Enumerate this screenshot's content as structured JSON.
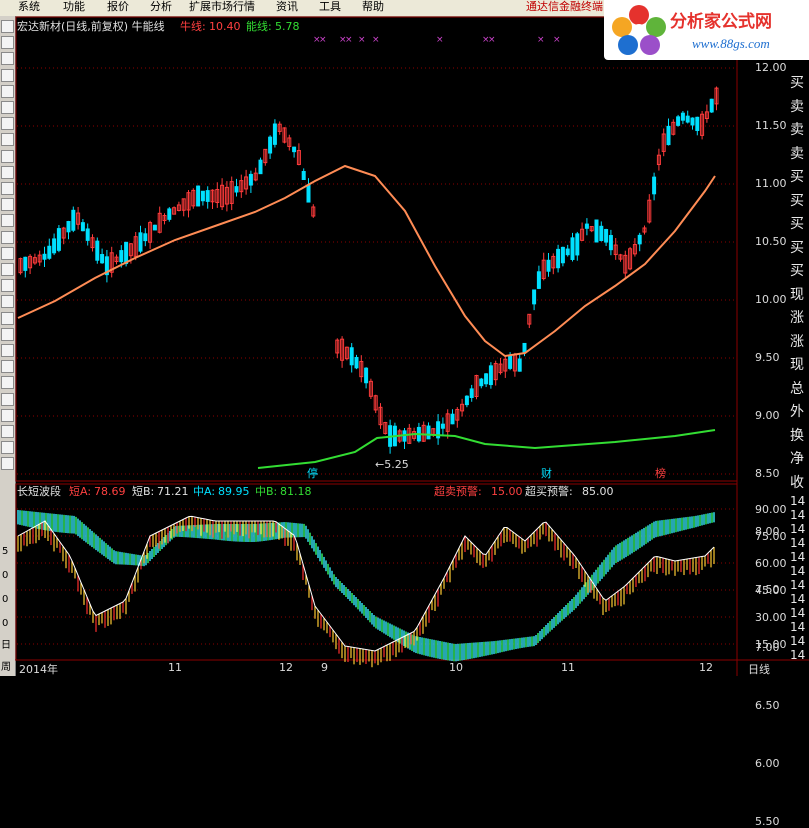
{
  "menu": {
    "items": [
      "系统",
      "功能",
      "报价",
      "分析",
      "扩展市场行情",
      "资讯",
      "工具",
      "帮助"
    ],
    "promo": "通达信金融终端"
  },
  "logo": {
    "brand": "分析家公式网",
    "url": "www.88gs.com"
  },
  "toolbar": {
    "side_numbers": [
      "5",
      "0",
      "0",
      "0"
    ],
    "bottom_labels": [
      "日",
      "周"
    ]
  },
  "main_panel": {
    "title": "宏达新材(日线,前复权) 牛能线",
    "ind1_label": "牛线:",
    "ind1_value": "10.40",
    "ind2_label": "能线:",
    "ind2_value": "5.78",
    "low_marker": "←5.25",
    "event_labels": [
      "停",
      "财",
      "榜"
    ],
    "markers": "×",
    "y_ticks": [
      "12.00",
      "11.50",
      "11.00",
      "10.50",
      "10.00",
      "9.50",
      "9.00",
      "8.50",
      "8.00",
      "7.50",
      "7.00",
      "6.50",
      "6.00",
      "5.50"
    ],
    "side_text": [
      "买",
      "卖",
      "卖",
      "卖",
      "买",
      "买",
      "买",
      "买",
      "买",
      "现",
      "涨",
      "涨",
      "现",
      "总",
      "外",
      "换",
      "净",
      "收"
    ],
    "side_partial": [
      "14",
      "14",
      "14",
      "14",
      "14",
      "14",
      "14",
      "14",
      "14",
      "14",
      "14",
      "14"
    ]
  },
  "sub_panel": {
    "title": "长短波段",
    "a_label": "短A:",
    "a_value": "78.69",
    "b_label": "短B:",
    "b_value": "71.21",
    "c_label": "中A:",
    "c_value": "89.95",
    "d_label": "中B:",
    "d_value": "81.18",
    "sell_label": "超卖预警:",
    "sell_value": "15.00",
    "buy_label": "超买预警:",
    "buy_value": "85.00",
    "y_ticks": [
      "90.00",
      "75.00",
      "60.00",
      "45.00",
      "30.00",
      "15.00"
    ]
  },
  "x_axis": {
    "labels": [
      "2014年",
      "11",
      "12",
      "9",
      "10",
      "11",
      "12"
    ],
    "period": "日线"
  },
  "colors": {
    "up": "#ff3b3b",
    "down": "#00e0ff",
    "ma_orange": "#ff8c55",
    "ma_green": "#33dd33",
    "grid": "#8b0000",
    "marker": "#cc44cc",
    "label_red": "#ff4040",
    "label_white": "#e0e0e0"
  },
  "chart_data": {
    "type": "candlestick",
    "price_range": [
      5.25,
      12.1
    ],
    "low": 5.25,
    "bull_line_last": 10.4,
    "energy_line_last": 5.78,
    "oscillator_range": [
      10,
      95
    ],
    "thresholds": {
      "oversold": 15.0,
      "overbought": 85.0
    }
  }
}
